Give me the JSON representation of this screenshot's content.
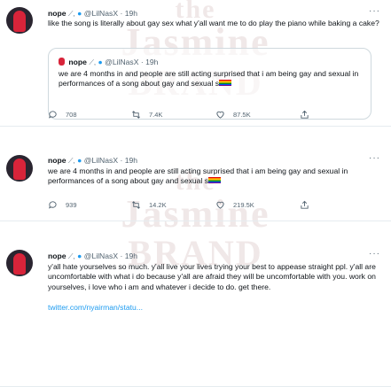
{
  "watermark": {
    "lines": [
      "the",
      "Jasmine",
      "BRAND",
      "the",
      "Jasmine",
      "BRAND"
    ]
  },
  "tweets": [
    {
      "name": "nope",
      "icons": "🥀, 🔵",
      "handle": "@LilNasX",
      "time": "· 19h",
      "more": "···",
      "text": "like the song is literally about gay sex what y'all want me to do play the piano while baking a cake?",
      "quote": {
        "name": "nope",
        "handle": "@LilNasX",
        "time": "· 19h",
        "text": "we are 4 months in and people are still acting surprised that i am being gay and sexual in performances of a song about gay and sexual s"
      },
      "replies": "708",
      "retweets": "7.4K",
      "likes": "87.5K"
    },
    {
      "name": "nope",
      "handle": "@LilNasX",
      "time": "· 19h",
      "more": "···",
      "text": "we are 4 months in and people are still acting surprised that i am being gay and sexual in performances of a song about gay and sexual s",
      "replies": "939",
      "retweets": "14.2K",
      "likes": "219.5K"
    },
    {
      "name": "nope",
      "handle": "@LilNasX",
      "time": "· 19h",
      "more": "···",
      "text": "y'all hate yourselves so much. y'all live your lives trying your best to appease straight ppl. y'all are uncomfortable with what i do because y'all are afraid they will be uncomfortable with you. work on yourselves, i love who i am and whatever i decide to do. get there.",
      "link": "twitter.com/nyairman/statu..."
    }
  ],
  "colors": {
    "accent": "#1d9bf0",
    "muted": "#536471",
    "divider": "#e6ecf0"
  },
  "icons": [
    "avatar",
    "verified-badge-icon",
    "reply-icon",
    "retweet-icon",
    "like-icon",
    "share-icon",
    "more-icon"
  ]
}
